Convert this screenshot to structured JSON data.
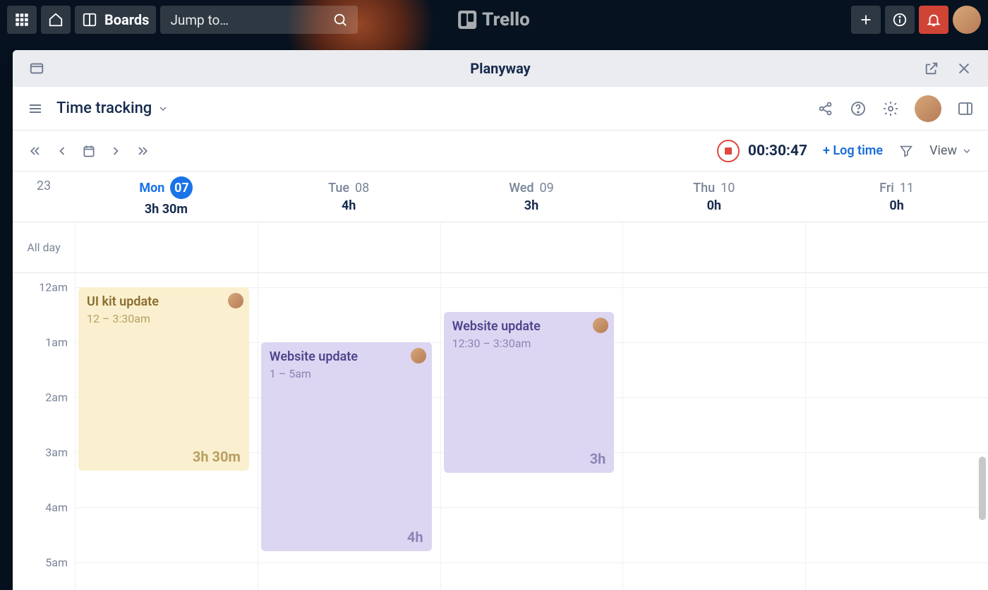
{
  "trello": {
    "boards_label": "Boards",
    "search_placeholder": "Jump to…",
    "logo_text": "Trello"
  },
  "modal": {
    "title": "Planyway"
  },
  "toolbar": {
    "view": "Time tracking"
  },
  "nav": {
    "timer": "00:30:47",
    "log_time": "+ Log time",
    "view_label": "View"
  },
  "week": {
    "gutter": "23",
    "days": [
      {
        "name": "Mon",
        "num": "07",
        "today": true,
        "total": "3h 30m"
      },
      {
        "name": "Tue",
        "num": "08",
        "today": false,
        "total": "4h"
      },
      {
        "name": "Wed",
        "num": "09",
        "today": false,
        "total": "3h"
      },
      {
        "name": "Thu",
        "num": "10",
        "today": false,
        "total": "0h"
      },
      {
        "name": "Fri",
        "num": "11",
        "today": false,
        "total": "0h"
      }
    ]
  },
  "allday_label": "All day",
  "hours": [
    "12am",
    "1am",
    "2am",
    "3am",
    "4am",
    "5am"
  ],
  "events": {
    "mon": {
      "title": "UI kit update",
      "time": "12 – 3:30am",
      "dur": "3h 30m"
    },
    "tue": {
      "title": "Website update",
      "time": "1 – 5am",
      "dur": "4h"
    },
    "wed": {
      "title": "Website update",
      "time": "12:30 – 3:30am",
      "dur": "3h"
    }
  }
}
